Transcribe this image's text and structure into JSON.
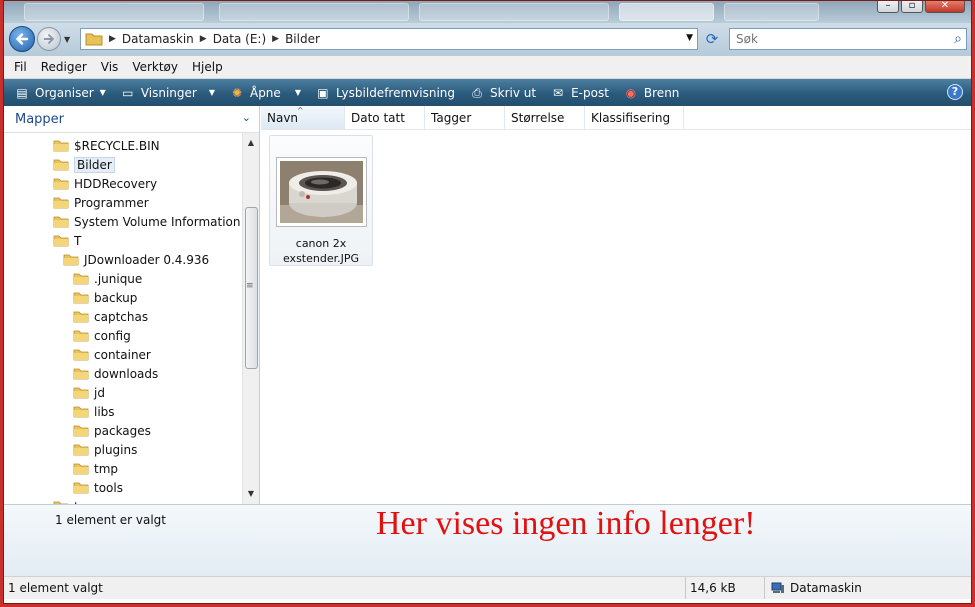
{
  "address": {
    "crumbs": [
      "Datamaskin",
      "Data (E:)",
      "Bilder"
    ],
    "search_placeholder": "Søk"
  },
  "menu": [
    "Fil",
    "Rediger",
    "Vis",
    "Verktøy",
    "Hjelp"
  ],
  "commands": [
    {
      "label": "Organiser",
      "icon": "organize-icon"
    },
    {
      "label": "Visninger",
      "icon": "views-icon"
    },
    {
      "label": "Åpne",
      "icon": "open-icon"
    },
    {
      "label": "Lysbildefremvisning",
      "icon": "slideshow-icon"
    },
    {
      "label": "Skriv ut",
      "icon": "printer-icon"
    },
    {
      "label": "E-post",
      "icon": "email-icon"
    },
    {
      "label": "Brenn",
      "icon": "burn-icon"
    }
  ],
  "nav": {
    "title": "Mapper",
    "items": [
      {
        "label": "$RECYCLE.BIN",
        "level": 0
      },
      {
        "label": "Bilder",
        "level": 0,
        "selected": true
      },
      {
        "label": "HDDRecovery",
        "level": 0
      },
      {
        "label": "Programmer",
        "level": 0
      },
      {
        "label": "System Volume Information",
        "level": 0
      },
      {
        "label": "T",
        "level": 0
      },
      {
        "label": "JDownloader 0.4.936",
        "level": 1
      },
      {
        "label": ".junique",
        "level": 2
      },
      {
        "label": "backup",
        "level": 2
      },
      {
        "label": "captchas",
        "level": 2
      },
      {
        "label": "config",
        "level": 2
      },
      {
        "label": "container",
        "level": 2
      },
      {
        "label": "downloads",
        "level": 2
      },
      {
        "label": "jd",
        "level": 2
      },
      {
        "label": "libs",
        "level": 2
      },
      {
        "label": "packages",
        "level": 2
      },
      {
        "label": "plugins",
        "level": 2
      },
      {
        "label": "tmp",
        "level": 2
      },
      {
        "label": "tools",
        "level": 2
      },
      {
        "label": "temp",
        "level": 0
      }
    ]
  },
  "columns": [
    "Navn",
    "Dato tatt",
    "Tagger",
    "Størrelse",
    "Klassifisering"
  ],
  "files": [
    {
      "name_line1": "canon 2x",
      "name_line2": "exstender.JPG"
    }
  ],
  "details": {
    "selection_text": "1 element er valgt",
    "annotation": "Her vises ingen info lenger!"
  },
  "status": {
    "left": "1 element valgt",
    "size": "14,6 kB",
    "location": "Datamaskin"
  },
  "colors": {
    "annotation": "#e31010",
    "command_bar": "#2a5a7c",
    "frame": "#c9302b"
  }
}
